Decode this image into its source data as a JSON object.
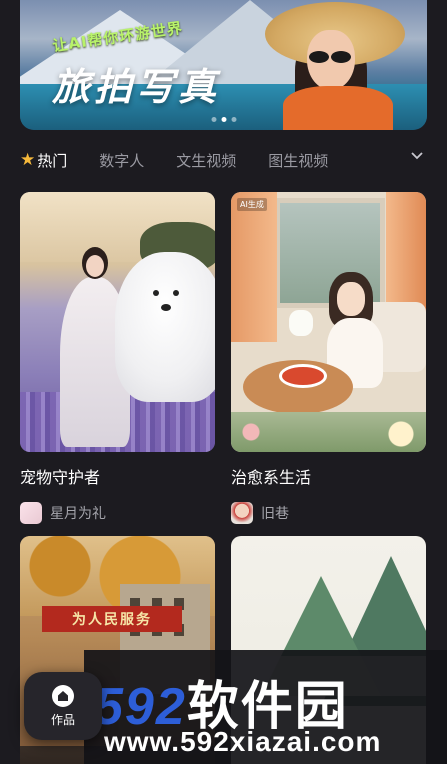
{
  "banner": {
    "subtitle": "让AI帮你环游世界",
    "title": "旅拍写真",
    "dots": 3,
    "active_dot": 1
  },
  "tabs": [
    {
      "label": "热门",
      "active": true,
      "icon": "star-icon"
    },
    {
      "label": "数字人",
      "active": false
    },
    {
      "label": "文生视频",
      "active": false
    },
    {
      "label": "图生视频",
      "active": false
    }
  ],
  "cards": [
    {
      "title": "宠物守护者",
      "author": "星月为礼"
    },
    {
      "title": "治愈系生活",
      "author": "旧巷",
      "thumb_tag": "AI生成"
    },
    {
      "title": "",
      "author": "",
      "sign_text": "为人民服务"
    },
    {
      "title": "",
      "author": ""
    }
  ],
  "bottom_tab": {
    "label": "作品",
    "icon": "home-icon"
  },
  "watermark": {
    "digits": "592",
    "text": "软件园",
    "url": "www.592xiazai.com"
  },
  "colors": {
    "background": "#1c1b20",
    "accent_star": "#f6b93b",
    "watermark_blue": "#2d5ed8"
  }
}
